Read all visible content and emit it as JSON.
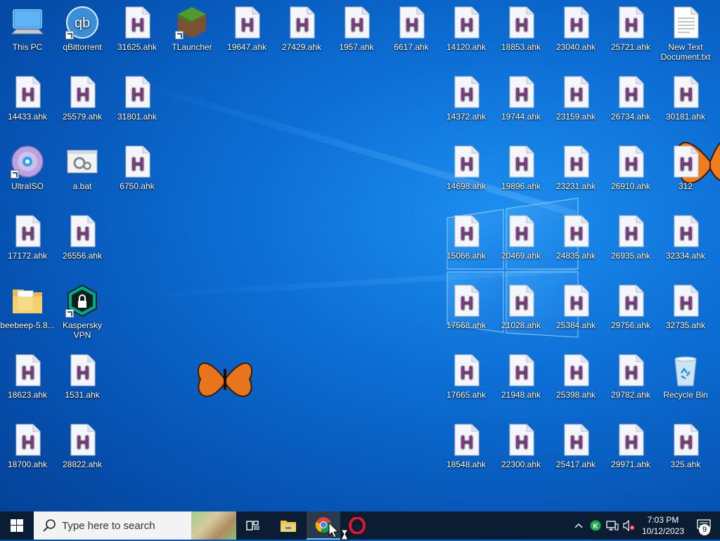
{
  "desktop_icons": [
    {
      "label": "This PC",
      "type": "pc",
      "col": 0,
      "row": 0
    },
    {
      "label": "qBittorrent",
      "type": "qbit",
      "col": 1,
      "row": 0,
      "shortcut": true
    },
    {
      "label": "31625.ahk",
      "type": "ahk",
      "col": 2,
      "row": 0
    },
    {
      "label": "TLauncher",
      "type": "tlauncher",
      "col": 3,
      "row": 0,
      "shortcut": true
    },
    {
      "label": "19647.ahk",
      "type": "ahk",
      "col": 4,
      "row": 0
    },
    {
      "label": "27429.ahk",
      "type": "ahk",
      "col": 5,
      "row": 0
    },
    {
      "label": "1957.ahk",
      "type": "ahk",
      "col": 6,
      "row": 0
    },
    {
      "label": "6617.ahk",
      "type": "ahk",
      "col": 7,
      "row": 0
    },
    {
      "label": "14120.ahk",
      "type": "ahk",
      "col": 8,
      "row": 0
    },
    {
      "label": "18853.ahk",
      "type": "ahk",
      "col": 9,
      "row": 0
    },
    {
      "label": "23040.ahk",
      "type": "ahk",
      "col": 10,
      "row": 0
    },
    {
      "label": "25721.ahk",
      "type": "ahk",
      "col": 11,
      "row": 0
    },
    {
      "label": "New Text Document.txt",
      "type": "txt",
      "col": 12,
      "row": 0
    },
    {
      "label": "14433.ahk",
      "type": "ahk",
      "col": 0,
      "row": 1
    },
    {
      "label": "25579.ahk",
      "type": "ahk",
      "col": 1,
      "row": 1
    },
    {
      "label": "31801.ahk",
      "type": "ahk",
      "col": 2,
      "row": 1
    },
    {
      "label": "14372.ahk",
      "type": "ahk",
      "col": 8,
      "row": 1
    },
    {
      "label": "19744.ahk",
      "type": "ahk",
      "col": 9,
      "row": 1
    },
    {
      "label": "23159.ahk",
      "type": "ahk",
      "col": 10,
      "row": 1
    },
    {
      "label": "26734.ahk",
      "type": "ahk",
      "col": 11,
      "row": 1
    },
    {
      "label": "30181.ahk",
      "type": "ahk",
      "col": 12,
      "row": 1
    },
    {
      "label": "UltraISO",
      "type": "disc",
      "col": 0,
      "row": 2,
      "shortcut": true
    },
    {
      "label": "a.bat",
      "type": "bat",
      "col": 1,
      "row": 2
    },
    {
      "label": "6750.ahk",
      "type": "ahk",
      "col": 2,
      "row": 2
    },
    {
      "label": "14698.ahk",
      "type": "ahk",
      "col": 8,
      "row": 2
    },
    {
      "label": "19896.ahk",
      "type": "ahk",
      "col": 9,
      "row": 2
    },
    {
      "label": "23231.ahk",
      "type": "ahk",
      "col": 10,
      "row": 2
    },
    {
      "label": "26910.ahk",
      "type": "ahk",
      "col": 11,
      "row": 2
    },
    {
      "label": "312",
      "type": "ahk",
      "col": 12,
      "row": 2
    },
    {
      "label": "17172.ahk",
      "type": "ahk",
      "col": 0,
      "row": 3
    },
    {
      "label": "26556.ahk",
      "type": "ahk",
      "col": 1,
      "row": 3
    },
    {
      "label": "15066.ahk",
      "type": "ahk",
      "col": 8,
      "row": 3
    },
    {
      "label": "20469.ahk",
      "type": "ahk",
      "col": 9,
      "row": 3
    },
    {
      "label": "24835.ahk",
      "type": "ahk",
      "col": 10,
      "row": 3
    },
    {
      "label": "26935.ahk",
      "type": "ahk",
      "col": 11,
      "row": 3
    },
    {
      "label": "32334.ahk",
      "type": "ahk",
      "col": 12,
      "row": 3
    },
    {
      "label": "beebeep-5.8...",
      "type": "folder",
      "col": 0,
      "row": 4
    },
    {
      "label": "Kaspersky VPN",
      "type": "kvpn",
      "col": 1,
      "row": 4,
      "shortcut": true
    },
    {
      "label": "17568.ahk",
      "type": "ahk",
      "col": 8,
      "row": 4
    },
    {
      "label": "21028.ahk",
      "type": "ahk",
      "col": 9,
      "row": 4
    },
    {
      "label": "25384.ahk",
      "type": "ahk",
      "col": 10,
      "row": 4
    },
    {
      "label": "29756.ahk",
      "type": "ahk",
      "col": 11,
      "row": 4
    },
    {
      "label": "32735.ahk",
      "type": "ahk",
      "col": 12,
      "row": 4
    },
    {
      "label": "18623.ahk",
      "type": "ahk",
      "col": 0,
      "row": 5
    },
    {
      "label": "1531.ahk",
      "type": "ahk",
      "col": 1,
      "row": 5
    },
    {
      "label": "17665.ahk",
      "type": "ahk",
      "col": 8,
      "row": 5
    },
    {
      "label": "21948.ahk",
      "type": "ahk",
      "col": 9,
      "row": 5
    },
    {
      "label": "25398.ahk",
      "type": "ahk",
      "col": 10,
      "row": 5
    },
    {
      "label": "29782.ahk",
      "type": "ahk",
      "col": 11,
      "row": 5
    },
    {
      "label": "Recycle Bin",
      "type": "bin",
      "col": 12,
      "row": 5
    },
    {
      "label": "18700.ahk",
      "type": "ahk",
      "col": 0,
      "row": 6
    },
    {
      "label": "28822.ahk",
      "type": "ahk",
      "col": 1,
      "row": 6
    },
    {
      "label": "18548.ahk",
      "type": "ahk",
      "col": 8,
      "row": 6
    },
    {
      "label": "22300.ahk",
      "type": "ahk",
      "col": 9,
      "row": 6
    },
    {
      "label": "25417.ahk",
      "type": "ahk",
      "col": 10,
      "row": 6
    },
    {
      "label": "29971.ahk",
      "type": "ahk",
      "col": 11,
      "row": 6
    },
    {
      "label": "325.ahk",
      "type": "ahk",
      "col": 12,
      "row": 6
    }
  ],
  "taskbar": {
    "search_placeholder": "Type here to search",
    "start_icon": "windows-logo-icon",
    "apps": [
      "task-view-icon",
      "file-explorer-icon",
      "chrome-icon",
      "opera-icon"
    ],
    "tray": [
      "chevron-up-icon",
      "kaspersky-tray-icon",
      "network-icon",
      "volume-muted-icon"
    ],
    "time": "7:03 PM",
    "date": "10/12/2023",
    "notification_count": "9"
  },
  "colors": {
    "ahk_letter": "#7b3a7f",
    "taskbar": "#0a1d33",
    "desktop_blue": "#0d6fd6"
  }
}
